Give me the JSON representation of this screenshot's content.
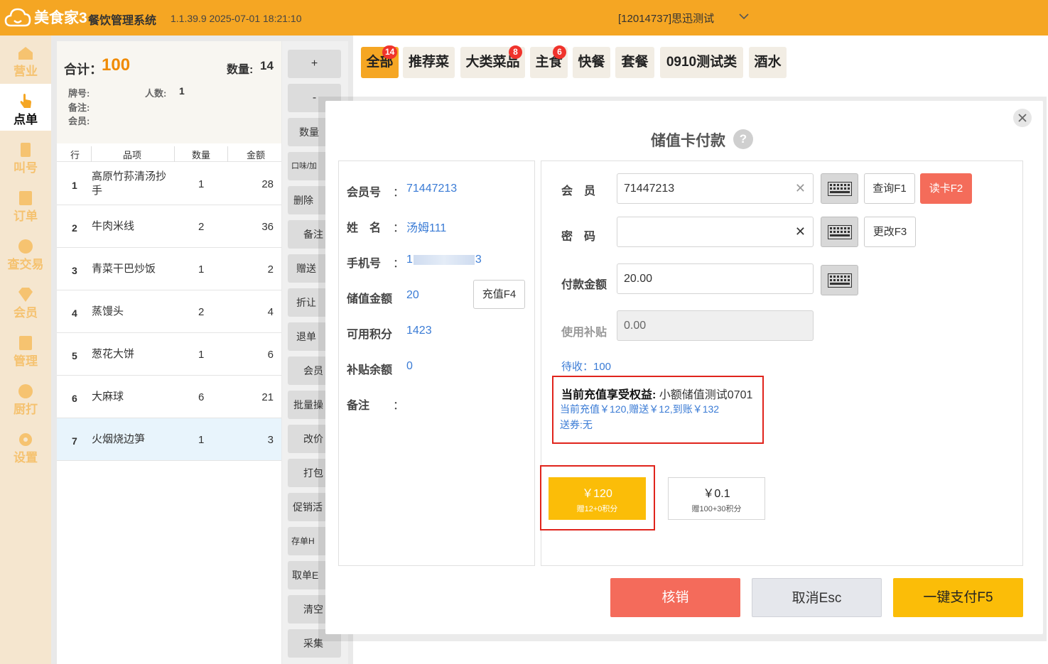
{
  "app": {
    "logo_text": "美食家3",
    "system_name": "餐饮管理系统",
    "version_time": "1.1.39.9 2025-07-01 18:21:10",
    "store": "[12014737]思迅测试"
  },
  "nav": [
    {
      "label": "营业",
      "icon": "store-icon"
    },
    {
      "label": "点单",
      "icon": "tap-hand-icon"
    },
    {
      "label": "叫号",
      "icon": "number-icon"
    },
    {
      "label": "订单",
      "icon": "list-icon"
    },
    {
      "label": "查交易",
      "icon": "search-icon"
    },
    {
      "label": "会员",
      "icon": "diamond-icon"
    },
    {
      "label": "管理",
      "icon": "manage-icon"
    },
    {
      "label": "厨打",
      "icon": "kitchen-print-icon"
    },
    {
      "label": "设置",
      "icon": "gear-icon"
    }
  ],
  "order": {
    "total_label": "合计：",
    "total_value": "100",
    "qty_label": "数量:",
    "qty_value": "14",
    "table_no_label": "牌号:",
    "people_label": "人数:",
    "people_value": "1",
    "remark_label": "备注:",
    "member_label": "会员:",
    "columns": [
      "行",
      "品项",
      "数量",
      "金额"
    ],
    "rows": [
      {
        "no": "1",
        "name": "高原竹荪清汤抄手",
        "qty": "1",
        "amount": "28"
      },
      {
        "no": "2",
        "name": "牛肉米线",
        "qty": "2",
        "amount": "36"
      },
      {
        "no": "3",
        "name": "青菜干巴炒饭",
        "qty": "1",
        "amount": "2"
      },
      {
        "no": "4",
        "name": "蒸馒头",
        "qty": "2",
        "amount": "4"
      },
      {
        "no": "5",
        "name": "葱花大饼",
        "qty": "1",
        "amount": "6"
      },
      {
        "no": "6",
        "name": "大麻球",
        "qty": "6",
        "amount": "21"
      },
      {
        "no": "7",
        "name": "火烟烧边笋",
        "qty": "1",
        "amount": "3"
      }
    ]
  },
  "mid_buttons": [
    "+",
    "-",
    "数量",
    "口味/加",
    "删除",
    "备注",
    "赠送",
    "折让",
    "退单",
    "会员",
    "批量操",
    "改价",
    "打包",
    "促销活",
    "存单H",
    "取单E",
    "清空",
    "采集"
  ],
  "categories": [
    {
      "label": "全部",
      "badge": "14"
    },
    {
      "label": "推荐菜",
      "badge": ""
    },
    {
      "label": "大类菜品",
      "badge": "8"
    },
    {
      "label": "主食",
      "badge": "6"
    },
    {
      "label": "快餐",
      "badge": ""
    },
    {
      "label": "套餐",
      "badge": ""
    },
    {
      "label": "0910测试类",
      "badge": ""
    },
    {
      "label": "酒水",
      "badge": ""
    }
  ],
  "modal": {
    "title": "储值卡付款",
    "help": "?",
    "info": {
      "member_no_label": "会员号",
      "member_no": "71447213",
      "name_label": "姓　名",
      "name": "汤姆111",
      "phone_label": "手机号",
      "phone_start": "1",
      "phone_end": "3",
      "balance_label": "储值金额",
      "balance": "20",
      "points_label": "可用积分",
      "points": "1423",
      "subsidy_label": "补贴余额",
      "subsidy": "0",
      "remark_label": "备注",
      "colon": "：",
      "recharge_btn": "充值F4"
    },
    "form": {
      "member_label": "会　员",
      "member_value": "71447213",
      "password_label": "密　码",
      "password_value": "",
      "pay_amount_label": "付款金额",
      "pay_amount": "20.00",
      "use_subsidy_label": "使用补贴",
      "use_subsidy": "0.00",
      "query_btn": "查询F1",
      "read_card_btn": "读卡F2",
      "change_btn": "更改F3",
      "pending": "待收：100"
    },
    "benefit": {
      "title": "当前充值享受权益:",
      "name": "小额储值测试0701",
      "line1": "当前充值￥120,赠送￥12,到账￥132",
      "line2": "送券:无"
    },
    "packages": [
      {
        "amount": "￥120",
        "desc": "赠12+0积分",
        "selected": true
      },
      {
        "amount": "￥0.1",
        "desc": "赠100+30积分",
        "selected": false
      }
    ],
    "buttons": {
      "verify": "核销",
      "cancel": "取消Esc",
      "pay": "一键支付F5"
    }
  }
}
